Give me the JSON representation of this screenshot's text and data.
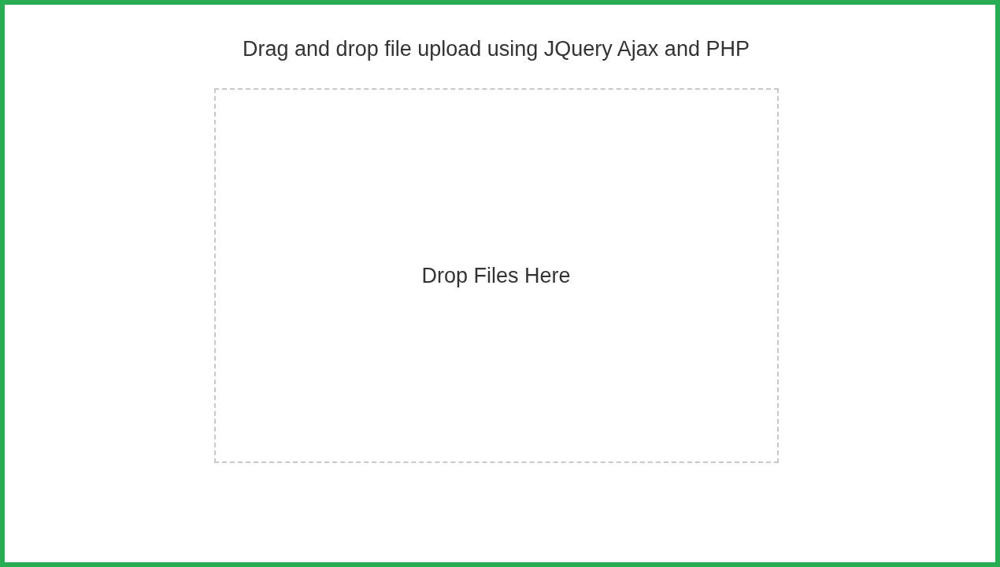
{
  "title": "Drag and drop file upload using JQuery Ajax and PHP",
  "drop_zone": {
    "label": "Drop Files Here"
  }
}
